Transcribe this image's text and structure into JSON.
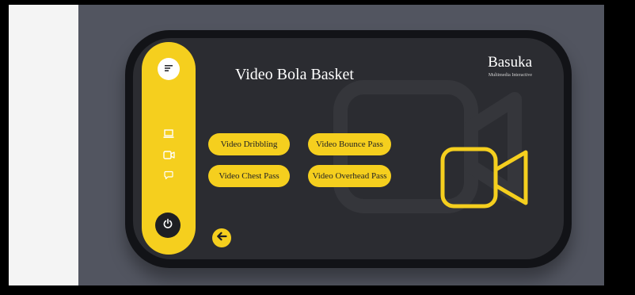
{
  "header": {
    "title": "Video Bola Basket"
  },
  "brand": {
    "name": "Basuka",
    "tagline": "Multimedia Interactive"
  },
  "buttons": {
    "dribbling": "Video Dribbling",
    "bounce_pass": "Video Bounce Pass",
    "chest_pass": "Video Chest Pass",
    "overhead_pass": "Video Overhead Pass"
  },
  "sidebar": {
    "icons": [
      "menu-icon",
      "laptop-icon",
      "video-icon",
      "chat-icon",
      "power-icon"
    ]
  },
  "colors": {
    "accent": "#f5cf1e",
    "screen": "#2b2c31",
    "frame": "#121317",
    "backdrop": "#525560"
  }
}
